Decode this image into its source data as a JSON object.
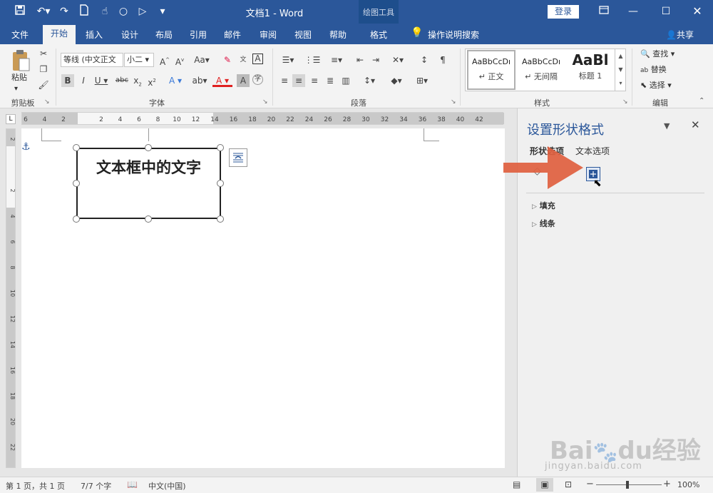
{
  "window": {
    "title": "文档1  -  Word",
    "context_group": "绘图工具",
    "login": "登录",
    "share": "共享"
  },
  "tabs": [
    "文件",
    "开始",
    "插入",
    "设计",
    "布局",
    "引用",
    "邮件",
    "审阅",
    "视图",
    "帮助",
    "格式"
  ],
  "search_tell": "操作说明搜索",
  "ribbon": {
    "clipboard": {
      "paste": "粘贴",
      "label": "剪贴板"
    },
    "font": {
      "name": "等线 (中文正文",
      "size": "小二",
      "label": "字体"
    },
    "paragraph": {
      "label": "段落"
    },
    "styles": {
      "label": "样式",
      "items": [
        {
          "preview": "AaBbCcDı",
          "name": "↵ 正文"
        },
        {
          "preview": "AaBbCcDı",
          "name": "↵ 无间隔"
        },
        {
          "preview": "AaBl",
          "name": "标题 1"
        }
      ]
    },
    "editing": {
      "find": "查找",
      "replace": "替换",
      "select": "选择",
      "label": "编辑"
    }
  },
  "ruler": {
    "h_ticks": [
      "6",
      "4",
      "2",
      "",
      "2",
      "4",
      "6",
      "8",
      "10",
      "12",
      "14",
      "16",
      "18",
      "20",
      "22",
      "24",
      "26",
      "28",
      "30",
      "32",
      "34",
      "36",
      "38",
      "40",
      "42"
    ],
    "v_ticks": [
      "2",
      "",
      "2",
      "4",
      "6",
      "8",
      "10",
      "12",
      "14",
      "16",
      "18",
      "20",
      "22"
    ]
  },
  "document": {
    "textbox_text": "文本框中的文字"
  },
  "pane": {
    "title": "设置形状格式",
    "tab_shape": "形状选项",
    "tab_text": "文本选项",
    "section_fill": "填充",
    "section_line": "线条"
  },
  "status": {
    "page": "第 1 页，共 1 页",
    "words": "7/7 个字",
    "language": "中文(中国)",
    "zoom": "100%"
  },
  "watermark": {
    "brand": "Baidu经验",
    "url": "jingyan.baidu.com"
  },
  "colors": {
    "ribbon_blue": "#2b579a",
    "arrow": "#e0603f",
    "font_red": "#e02020"
  }
}
